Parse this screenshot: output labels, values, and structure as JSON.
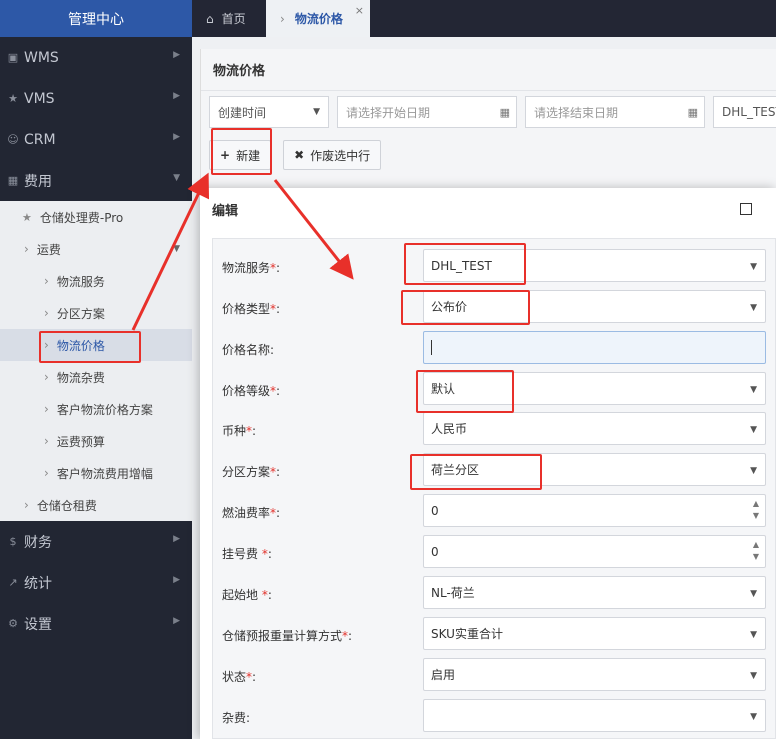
{
  "sidebar": {
    "brand": "管理中心",
    "top_items": [
      {
        "label": "WMS",
        "icon": "bank-icon"
      },
      {
        "label": "VMS",
        "icon": "star-icon"
      },
      {
        "label": "CRM",
        "icon": "user-icon"
      },
      {
        "label": "费用",
        "icon": "grid-icon"
      }
    ],
    "fee_submenu": [
      {
        "label": "仓储处理费-Pro"
      },
      {
        "label": "运费"
      },
      {
        "label": "物流服务"
      },
      {
        "label": "分区方案"
      },
      {
        "label": "物流价格"
      },
      {
        "label": "物流杂费"
      },
      {
        "label": "客户物流价格方案"
      },
      {
        "label": "运费预算"
      },
      {
        "label": "客户物流费用增幅"
      },
      {
        "label": "仓储仓租费"
      }
    ],
    "bottom_items": [
      {
        "label": "财务",
        "icon": "dollar-icon"
      },
      {
        "label": "统计",
        "icon": "chart-icon"
      },
      {
        "label": "设置",
        "icon": "gear-icon"
      }
    ]
  },
  "tabs": {
    "home": "首页",
    "active": "物流价格",
    "close": "×"
  },
  "page": {
    "title": "物流价格",
    "filters": {
      "time_select": "创建时间",
      "start_placeholder": "请选择开始日期",
      "end_placeholder": "请选择结束日期",
      "service_value": "DHL_TEST"
    },
    "buttons": {
      "new": "新建",
      "void": "作废选中行"
    }
  },
  "modal": {
    "title": "编辑",
    "fields": [
      {
        "label": "物流服务",
        "required": "*",
        "suffix": ":",
        "value": "DHL_TEST",
        "kind": "select"
      },
      {
        "label": "价格类型",
        "required": "*",
        "suffix": ":",
        "value": "公布价",
        "kind": "select"
      },
      {
        "label": "价格名称",
        "required": "",
        "suffix": ":",
        "value": "",
        "kind": "text"
      },
      {
        "label": "价格等级",
        "required": "*",
        "suffix": ":",
        "value": "默认",
        "kind": "select"
      },
      {
        "label": "币种",
        "required": "*",
        "suffix": ":",
        "value": "人民币",
        "kind": "select"
      },
      {
        "label": "分区方案",
        "required": "*",
        "suffix": ":",
        "value": "荷兰分区",
        "kind": "select"
      },
      {
        "label": "燃油费率",
        "required": "*",
        "suffix": ":",
        "value": "0",
        "kind": "number"
      },
      {
        "label": "挂号费 ",
        "required": "*",
        "suffix": ":",
        "value": "0",
        "kind": "number"
      },
      {
        "label": "起始地 ",
        "required": "*",
        "suffix": ":",
        "value": "NL-荷兰",
        "kind": "select"
      },
      {
        "label": "仓储预报重量计算方式",
        "required": "*",
        "suffix": ":",
        "value": "SKU实重合计",
        "kind": "select"
      },
      {
        "label": "状态",
        "required": "*",
        "suffix": ":",
        "value": "启用",
        "kind": "select"
      },
      {
        "label": "杂费",
        "required": "",
        "suffix": ":",
        "value": "",
        "kind": "select"
      }
    ]
  },
  "colors": {
    "sidebar_bg": "#222633",
    "brand_bg": "#2d58a7",
    "highlight_red": "#e8302a",
    "required_red": "#e2312a"
  }
}
